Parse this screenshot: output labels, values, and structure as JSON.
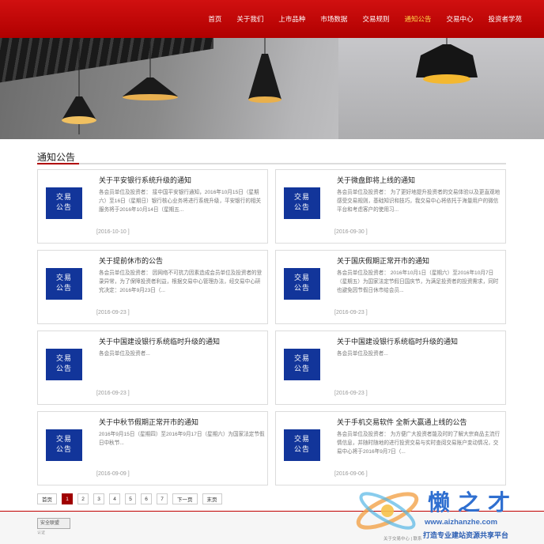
{
  "nav": {
    "items": [
      {
        "label": "首页"
      },
      {
        "label": "关于我们"
      },
      {
        "label": "上市品种"
      },
      {
        "label": "市场数据"
      },
      {
        "label": "交易规则"
      },
      {
        "label": "通知公告",
        "active": true
      },
      {
        "label": "交易中心"
      },
      {
        "label": "投资者学苑"
      }
    ]
  },
  "section": {
    "title": "通知公告"
  },
  "badge_label": "交易\n公告",
  "notices": [
    {
      "title": "关于平安银行系统升级的通知",
      "summary": "各会员单位及投资者： 接中国平安银行通知，2016年10月15日（星期六）至16日（星期日）银行核心业务将进行系统升级，平安银行的相关服务将于2016年10月14日（星期五...",
      "date": "[2016-10-10 ]"
    },
    {
      "title": "关于微盘即将上线的通知",
      "summary": "各会员单位及投资者： 为了更好地提升投资者的交易体验以及更直观地感受交易规则，基础知识和技巧，我交易中心将依托于海量用户的微信平台和考虑客户的使用习...",
      "date": "[2016-09-30 ]"
    },
    {
      "title": "关于提前休市的公告",
      "summary": "各会员单位及投资者： 因网络不可抗力因素造成会员单位及投资者的登录异常，为了保障投资者利益，根据交易中心管理办法，经交易中心研究决定：2016年9月23日（...",
      "date": "[2016-09-23 ]"
    },
    {
      "title": "关于国庆假期正常开市的通知",
      "summary": "各会员单位及投资者： 2016年10月1日（星期六）至2016年10月7日（星期五）为国家法定节假日国庆节，为满足投资者的投资需求，同时也避免因节假日休市给会员...",
      "date": "[2016-09-23 ]"
    },
    {
      "title": "关于中国建设银行系统临时升级的通知",
      "summary": "各会员单位及投资者...",
      "date": "[2016-09-23 ]"
    },
    {
      "title": "关于中国建设银行系统临时升级的通知",
      "summary": "各会员单位及投资者...",
      "date": "[2016-09-23 ]"
    },
    {
      "title": "关于中秋节假期正常开市的通知",
      "summary": "2016年9月15日（星期四）至2016年9月17日（星期六）为国家法定节假日中秋节...",
      "date": "[2016-09-09 ]"
    },
    {
      "title": "关于手机交易软件 全新大赢通上线的公告",
      "summary": "各会员单位及投资者： 为方便广大投资者能及时的了解大宗商品主流行情信息，并随时随地的进行投资交易与实时查阅交易账户变动情况，交易中心将于2016年9月7日（...",
      "date": "[2016-09-06 ]"
    }
  ],
  "pagination": {
    "first": "首页",
    "pages": [
      "1",
      "2",
      "3",
      "4",
      "5",
      "6",
      "7"
    ],
    "current": "1",
    "next": "下一页",
    "last": "末页"
  },
  "footer": {
    "logo_alt": "安全联盟",
    "logo_sub": "认证",
    "copyright": "关于交易中心 | 联系"
  },
  "watermark": {
    "title": "懒之才",
    "url": "www.aizhanzhe.com",
    "slogan": "打造专业建站资源共享平台"
  },
  "colors": {
    "brand_red": "#b00000",
    "nav_active": "#ffd54a",
    "badge_blue": "#12359a"
  }
}
